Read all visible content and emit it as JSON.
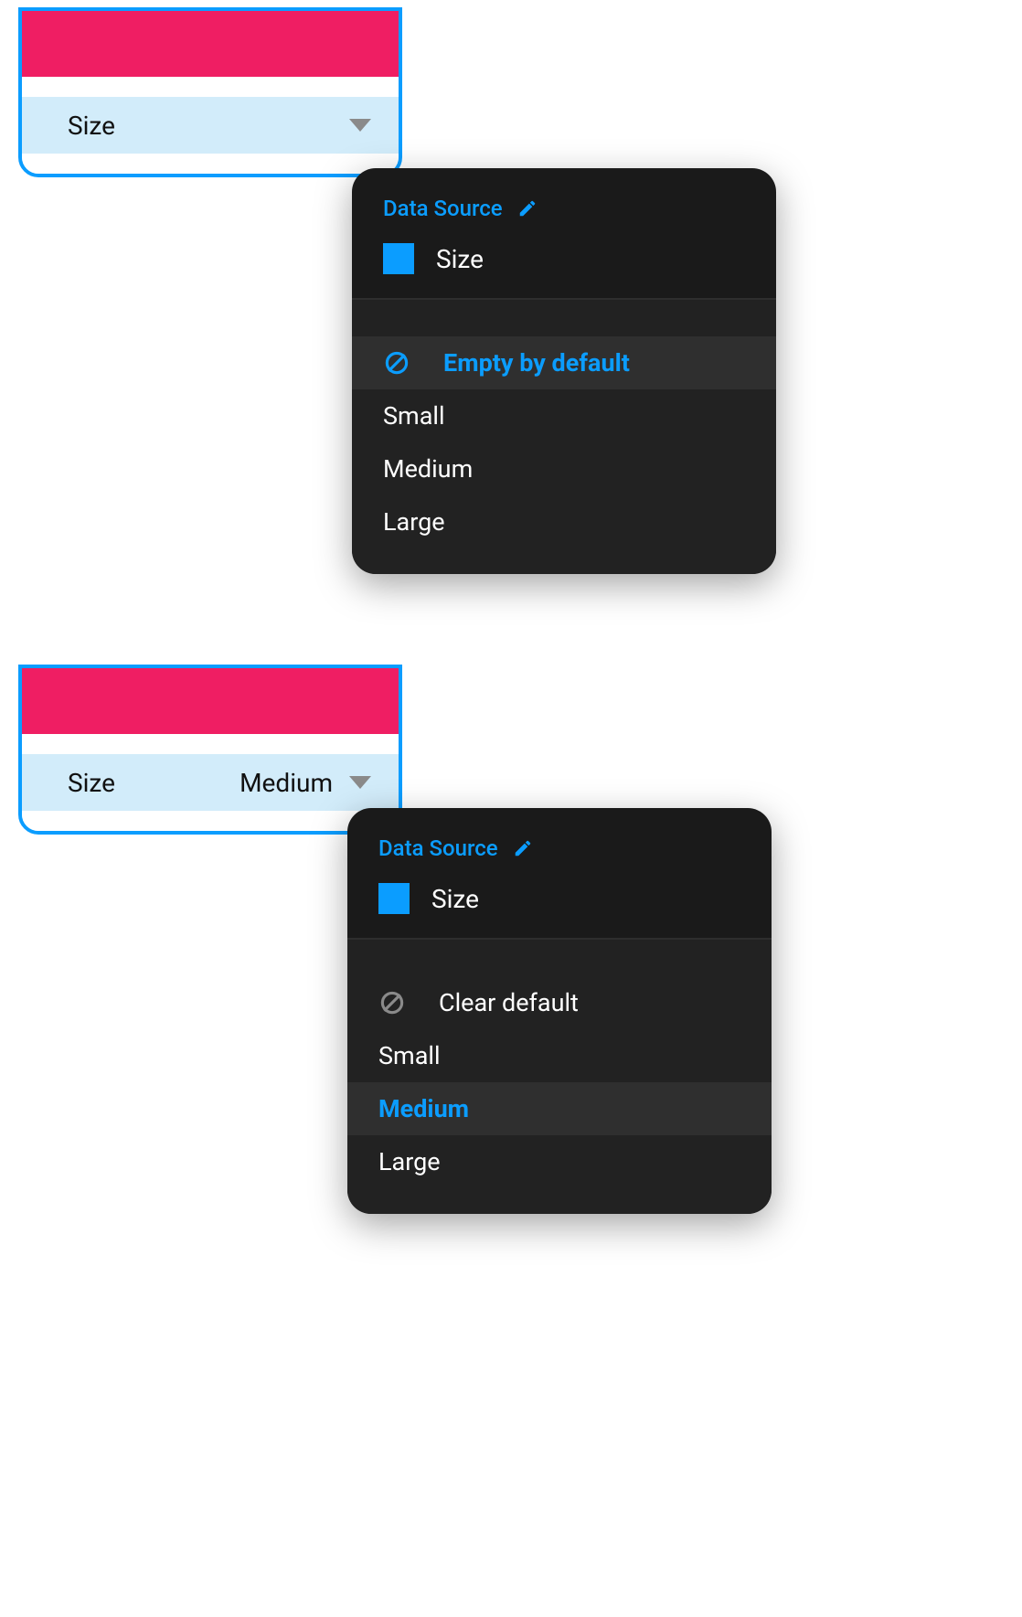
{
  "examples": [
    {
      "widget": {
        "label": "Size",
        "value": ""
      },
      "popover": {
        "dataSourceLabel": "Data Source",
        "fieldName": "Size",
        "clearOption": "Empty by default",
        "clearHighlighted": true,
        "clearAccent": true,
        "options": [
          {
            "label": "Small",
            "highlighted": false,
            "accent": false
          },
          {
            "label": "Medium",
            "highlighted": false,
            "accent": false
          },
          {
            "label": "Large",
            "highlighted": false,
            "accent": false
          }
        ]
      }
    },
    {
      "widget": {
        "label": "Size",
        "value": "Medium"
      },
      "popover": {
        "dataSourceLabel": "Data Source",
        "fieldName": "Size",
        "clearOption": "Clear default",
        "clearHighlighted": false,
        "clearAccent": false,
        "options": [
          {
            "label": "Small",
            "highlighted": false,
            "accent": false
          },
          {
            "label": "Medium",
            "highlighted": true,
            "accent": true
          },
          {
            "label": "Large",
            "highlighted": false,
            "accent": false
          }
        ]
      }
    }
  ]
}
